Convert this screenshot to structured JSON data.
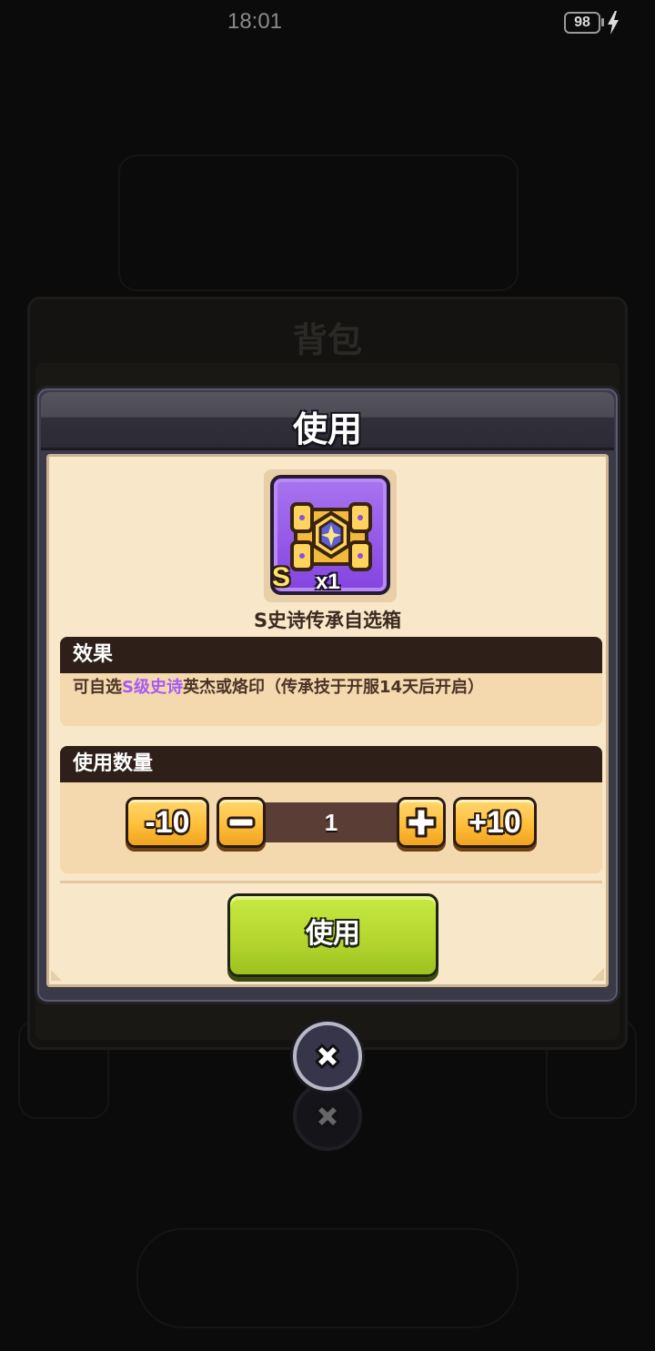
{
  "status_bar": {
    "time": "18:01",
    "battery": "98"
  },
  "background": {
    "panel_title": "背包"
  },
  "modal": {
    "title": "使用",
    "item": {
      "name": "S史诗传承自选箱",
      "grade": "S",
      "count": "x1"
    },
    "effect": {
      "heading": "效果",
      "text_prefix": "可自选",
      "text_highlight": "S级史诗",
      "text_suffix": "英杰或烙印（传承技于开服14天后开启）",
      "highlight_color": "#a65cf2"
    },
    "quantity": {
      "heading": "使用数量",
      "minus10_label": "-10",
      "plus10_label": "+10",
      "value": "1"
    },
    "use_button_label": "使用"
  },
  "icons": [
    "charging-icon",
    "chest-icon",
    "minus-icon",
    "plus-icon",
    "close-icon"
  ]
}
